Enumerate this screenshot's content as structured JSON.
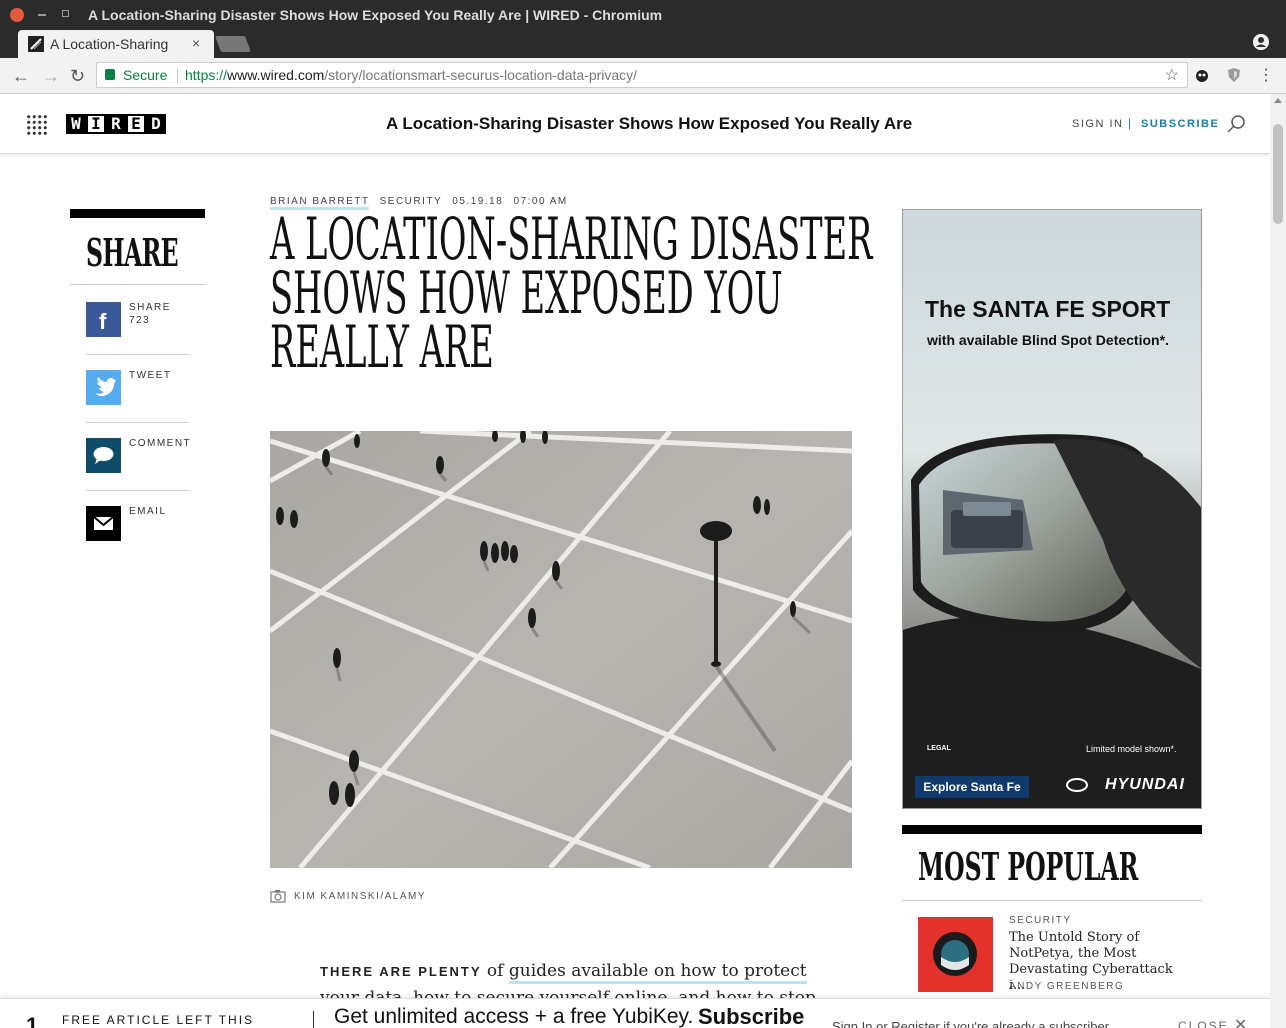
{
  "window": {
    "title": "A Location-Sharing Disaster Shows How Exposed You Really Are | WIRED - Chromium"
  },
  "tab": {
    "label": "A Location-Sharing",
    "close": "×"
  },
  "toolbar": {
    "back": "←",
    "forward": "→",
    "reload": "↻",
    "secure_label": "Secure",
    "url_scheme": "https://",
    "url_host": "www.wired.com",
    "url_path": "/story/locationsmart-securus-location-data-privacy/",
    "star": "☆"
  },
  "site": {
    "header_title": "A Location-Sharing Disaster Shows How Exposed You Really Are",
    "logo_letters": [
      "W",
      "I",
      "R",
      "E",
      "D"
    ],
    "sign_in": "SIGN IN",
    "separator": "|",
    "subscribe": "SUBSCRIBE"
  },
  "share": {
    "title": "SHARE",
    "items": [
      {
        "label": "SHARE",
        "count": "723",
        "icon": "facebook-icon",
        "color": "#3b5998"
      },
      {
        "label": "TWEET",
        "count": "",
        "icon": "twitter-icon",
        "color": "#55acee"
      },
      {
        "label": "COMMENT",
        "count": "",
        "icon": "comment-icon",
        "color": "#0e4c6a"
      },
      {
        "label": "EMAIL",
        "count": "",
        "icon": "email-icon",
        "color": "#000000"
      }
    ]
  },
  "article": {
    "author": "BRIAN BARRETT",
    "category": "SECURITY",
    "date": "05.19.18",
    "time": "07:00 AM",
    "headline_lines": [
      "A LOCATION-SHARING DISASTER",
      "SHOWS HOW EXPOSED YOU",
      "REALLY ARE"
    ],
    "photo_credit": "KIM KAMINSKI/ALAMY",
    "lede_lead": "THERE ARE PLENTY",
    "lede_part1": " of ",
    "lede_link": "guides available on how to protect",
    "lede_part2": " your data, how to secure yourself online, and how to stop"
  },
  "ad": {
    "headline": "The SANTA FE SPORT",
    "subhead": "with available Blind Spot Detection*.",
    "legal": "LEGAL",
    "disclaimer": "Limited model shown*.",
    "cta": "Explore Santa Fe",
    "brand": "HYUNDAI"
  },
  "most_popular": {
    "title": "MOST POPULAR",
    "items": [
      {
        "category": "SECURITY",
        "title": "The Untold Story of NotPetya, the Most Devastating Cyberattack i...",
        "author": "ANDY GREENBERG"
      }
    ]
  },
  "paywall": {
    "count": "1",
    "text": "FREE ARTICLE LEFT THIS",
    "offer": "Get unlimited access + a free YubiKey.",
    "subscribe": "Subscribe",
    "signin_text": "Sign In or Register if you're already a subscriber.",
    "close": "CLOSE",
    "close_x": "✕"
  }
}
